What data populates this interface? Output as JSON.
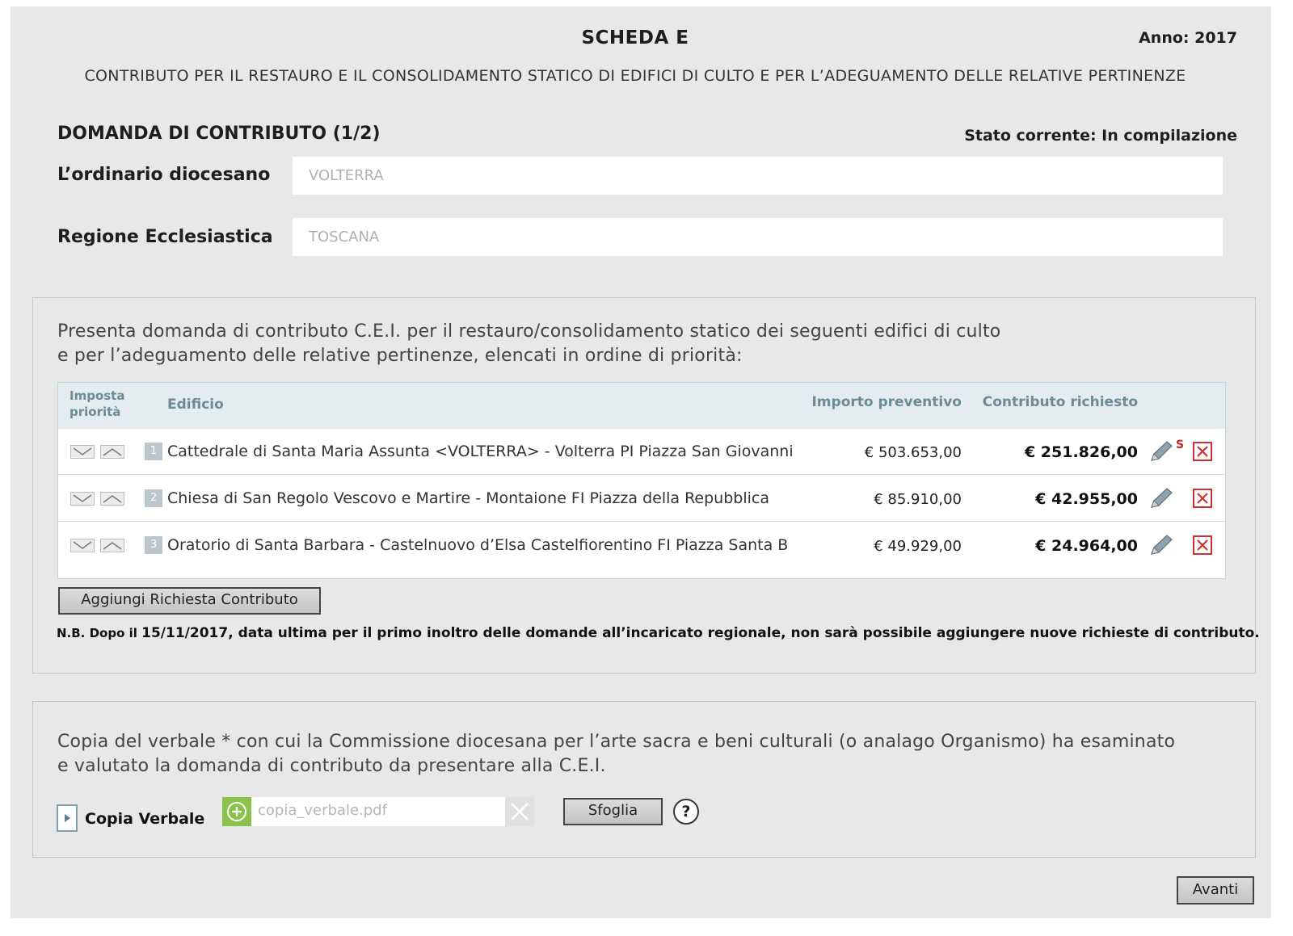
{
  "header": {
    "title": "SCHEDA E",
    "anno": "Anno: 2017",
    "subtitle": "CONTRIBUTO PER IL RESTAURO E IL CONSOLIDAMENTO STATICO DI EDIFICI DI CULTO E PER L’ADEGUAMENTO DELLE RELATIVE PERTINENZE"
  },
  "section": {
    "title": "DOMANDA DI CONTRIBUTO (1/2)",
    "stato": "Stato corrente: In compilazione"
  },
  "fields": {
    "ordinario_label": "L’ordinario diocesano",
    "ordinario_value": "VOLTERRA",
    "regione_label": "Regione Ecclesiastica",
    "regione_value": "TOSCANA"
  },
  "panel1": {
    "intro_line1": "Presenta domanda di contributo C.E.I. per il restauro/consolidamento statico dei seguenti edifici di culto",
    "intro_line2": "e per l’adeguamento delle relative pertinenze, elencati in ordine di priorità:",
    "table": {
      "col_priority_line1": "Imposta",
      "col_priority_line2": "priorità",
      "col_edificio": "Edificio",
      "col_importo": "Importo preventivo",
      "col_contributo": "Contributo richiesto",
      "rows": [
        {
          "num": "1",
          "edificio": "Cattedrale di Santa Maria Assunta <VOLTERRA> - Volterra PI Piazza San Giovanni",
          "importo": "€ 503.653,00",
          "contributo": "€ 251.826,00",
          "flag": "S"
        },
        {
          "num": "2",
          "edificio": "Chiesa di San Regolo Vescovo e Martire - Montaione FI Piazza della Repubblica",
          "importo": "€ 85.910,00",
          "contributo": "€ 42.955,00"
        },
        {
          "num": "3",
          "edificio": "Oratorio di Santa Barbara - Castelnuovo d’Elsa Castelfiorentino FI Piazza Santa B",
          "importo": "€ 49.929,00",
          "contributo": "€ 24.964,00"
        }
      ]
    },
    "add_button": "Aggiungi Richiesta Contributo",
    "nb_prefix": "N.B. Dopo il ",
    "nb_date": "15/11/2017",
    "nb_text": ", data ultima per il primo inoltro delle domande all’incaricato regionale, non sarà possibile aggiungere nuove richieste di contributo."
  },
  "panel2": {
    "intro_line1": "Copia del verbale * con cui la Commissione diocesana per l’arte sacra e beni culturali (o analago Organismo) ha esaminato",
    "intro_line2": "e valutato la domanda di contributo da presentare alla C.E.I.",
    "copia_label": "Copia Verbale",
    "file_placeholder": "copia_verbale.pdf",
    "browse_button": "Sfoglia",
    "help": "?"
  },
  "footer": {
    "next_button": "Avanti"
  },
  "icons": {
    "move_down": "chevron-down-icon",
    "move_up": "chevron-up-icon",
    "edit": "pencil-icon",
    "delete": "close-icon",
    "expand": "triangle-right-icon",
    "add_file": "plus-circle-icon",
    "clear_file": "clear-icon",
    "help": "help-icon"
  },
  "colors": {
    "background": "#e8e8e8",
    "header_text": "#6a8b98",
    "delete_red": "#d32f2f",
    "add_green": "#8bc34a"
  }
}
